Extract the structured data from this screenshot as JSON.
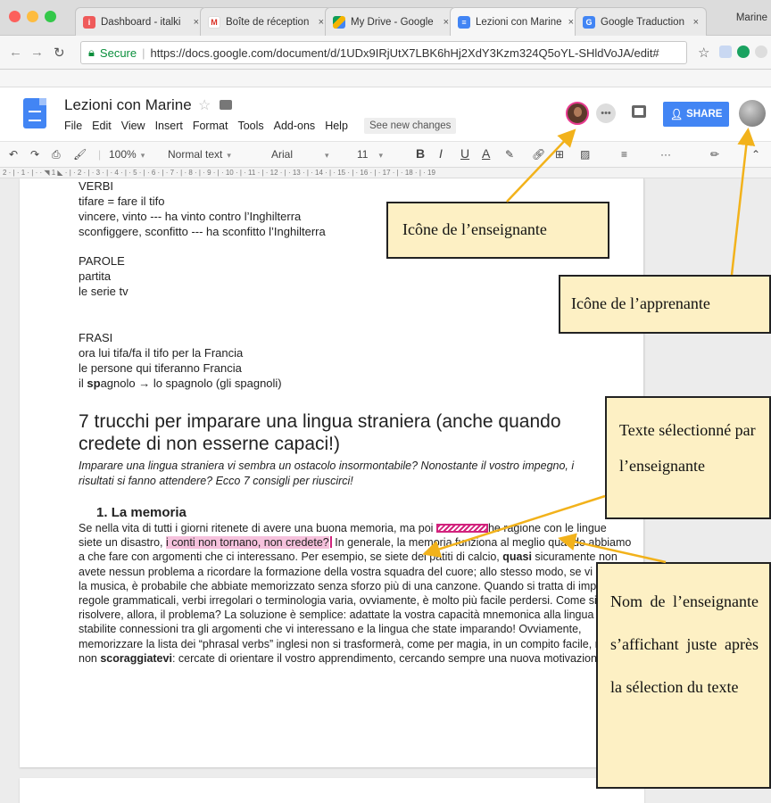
{
  "browser": {
    "tabs": [
      {
        "label": "Dashboard - italki",
        "icon": "italki-icon"
      },
      {
        "label": "Boîte de réception",
        "icon": "gmail-icon"
      },
      {
        "label": "My Drive - Google",
        "icon": "drive-icon"
      },
      {
        "label": "Lezioni con Marine",
        "icon": "docs-icon",
        "active": true
      },
      {
        "label": "Google Traduction",
        "icon": "translate-icon"
      }
    ],
    "tab_close": "×",
    "profile_name": "Marine",
    "secure_label": "Secure",
    "url": "https://docs.google.com/document/d/1UDx9IRjUtX7LBK6hHj2XdY3Kzm324Q5oYL-SHldVoJA/edit#"
  },
  "docs": {
    "title": "Lezioni con Marine",
    "menu": [
      "File",
      "Edit",
      "View",
      "Insert",
      "Format",
      "Tools",
      "Add-ons",
      "Help"
    ],
    "see_changes": "See new changes",
    "share_label": "SHARE",
    "toolbar": {
      "zoom": "100%",
      "style": "Normal text",
      "font": "Arial",
      "size": "11",
      "bold": "B",
      "italic": "I",
      "underline": "U",
      "text_color": "A",
      "more": "···"
    },
    "ruler": "2 · | · 1 · | · · ◥ 1 ◣ · | · 2 · | · 3 · | · 4 · | · 5 · | · 6 · | · 7 · | · 8 · | · 9 · | · 10 · | · 11 · | · 12 · | · 13 · | · 14 · | · 15 · | · 16 · | · 17 · | · 18 · | · 19"
  },
  "document": {
    "verbi_heading": "VERBI",
    "verbi_lines": [
      "tifare = fare il tifo",
      "vincere, vinto --- ha vinto contro l’Inghilterra",
      "sconfiggere, sconfitto --- ha sconfitto l’Inghilterra"
    ],
    "parole_heading": "PAROLE",
    "parole_lines": [
      "partita",
      "le serie tv"
    ],
    "frasi_heading": "FRASI",
    "frasi_lines": [
      "ora lui tifa/fa il tifo per la Francia",
      "le persone qui tiferanno Francia"
    ],
    "frasi_last": {
      "bold": "sp",
      "before": "il ",
      "after": "agnolo → lo spagnolo  (gli spagnoli)"
    },
    "article_title": "7 trucchi per imparare una lingua straniera (anche quando credete di non esserne capaci!)",
    "article_subtitle": "Imparare una lingua straniera vi sembra un ostacolo insormontabile? Nonostante il vostro impegno, i risultati si fanno attendere? Ecco 7 consigli per riuscirci!",
    "section_number": "1.",
    "section_title": "La memoria",
    "para": {
      "p1": "Se nella vita di tutti i giorni ritenete di avere una buona memoria, ma poi",
      "p2": "he ragione con le lingue siete un disastro, ",
      "highlight": "i conti non tornano, non credete?",
      "p3": " In generale, la memoria funziona al meglio quando abbiamo a che fare con argomenti che ci interessano. Per esempio, se siete dei patiti di calcio, ",
      "bold1": "quasi",
      "p4": " sicuramente non avete nessun problema a ricordare la formazione della vostra squadra del cuore; allo stesso modo, se vi piace la musica, è probabile che abbiate memorizzato senza sforzo più di una canzone. Quando si tratta di imparare regole grammaticali, verbi irregolari o terminologia varia, ovviamente, è molto più facile perdersi. Come si può risolvere, allora, il problema? La soluzione è semplice: adattate la vostra capacità mnemonica alla lingua e stabilite connessioni tra gli argomenti che vi interessano e la lingua che state imparando! Ovviamente, memorizzare la lista dei “phrasal verbs” inglesi non si trasformerà, come per magia, in un compito facile, ma non ",
      "bold2": "scoraggiatevi",
      "p5": ": cercate di orientare il vostro apprendimento, cercando sempre una nuova motivazione!"
    }
  },
  "annotations": {
    "teacher_icon": "Icône de l’enseignante",
    "learner_icon": "Icône de l’apprenante",
    "selected_text": "Texte sélectionné par l’enseignante",
    "teacher_name": "Nom de l’enseignante s’affichant juste après la sélection du texte"
  },
  "colors": {
    "share_blue": "#4285f4",
    "highlight_pink": "#f6c2dd",
    "teacher_pink": "#d2237d",
    "annotation_fill": "#fdf0c4",
    "arrow_yellow": "#f2b21b"
  }
}
